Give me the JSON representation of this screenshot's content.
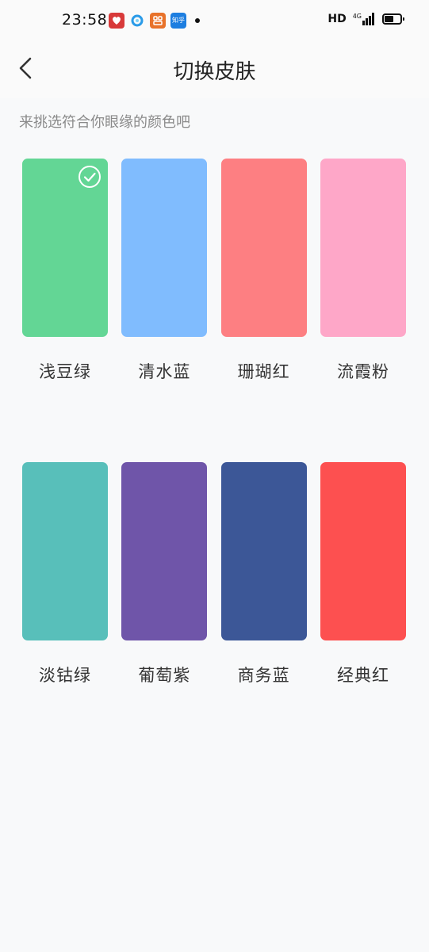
{
  "status_bar": {
    "time": "23:58",
    "hd": "HD",
    "network": "4G",
    "apps": [
      "pinduoduo-app-icon",
      "browser-app-icon",
      "meituan-app-icon",
      "zhihu-app-icon"
    ],
    "app_texts": {
      "zhihu": "知乎"
    },
    "battery_level": 0.6
  },
  "header": {
    "title": "切换皮肤"
  },
  "subtitle": "来挑选符合你眼缘的颜色吧",
  "skins": [
    {
      "name": "浅豆绿",
      "color": "#63d695",
      "selected": true
    },
    {
      "name": "清水蓝",
      "color": "#80bcfe",
      "selected": false
    },
    {
      "name": "珊瑚红",
      "color": "#fd7f82",
      "selected": false
    },
    {
      "name": "流霞粉",
      "color": "#fea7c8",
      "selected": false
    },
    {
      "name": "淡钴绿",
      "color": "#58bfba",
      "selected": false
    },
    {
      "name": "葡萄紫",
      "color": "#6f55a9",
      "selected": false
    },
    {
      "name": "商务蓝",
      "color": "#3c5797",
      "selected": false
    },
    {
      "name": "经典红",
      "color": "#fd5050",
      "selected": false
    }
  ]
}
